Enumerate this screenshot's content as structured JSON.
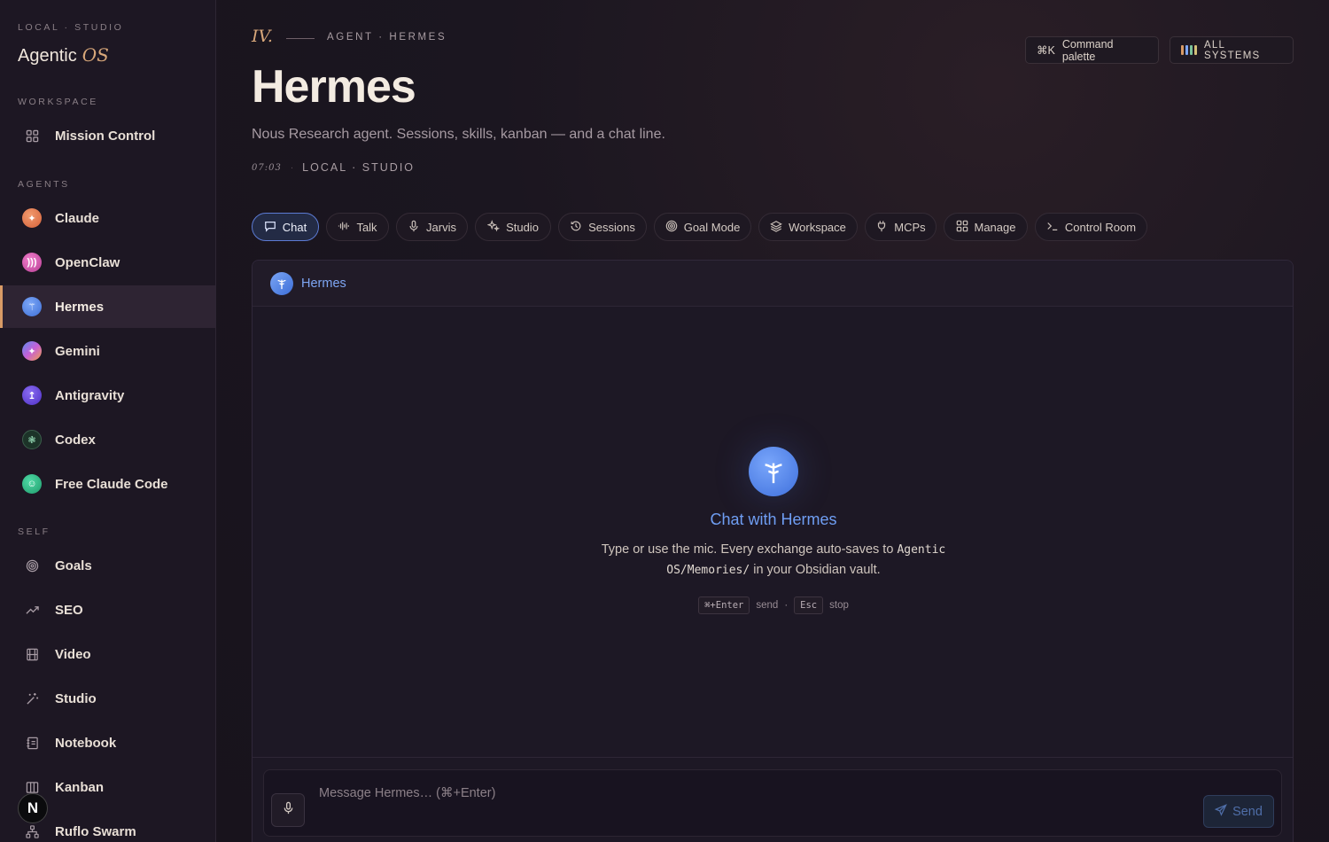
{
  "brand": {
    "eyebrow": "LOCAL · STUDIO",
    "name": "Agentic",
    "name_accent": "OS"
  },
  "sidebar": {
    "workspace_label": "WORKSPACE",
    "workspace_items": [
      {
        "label": "Mission Control",
        "icon": "grid-icon"
      }
    ],
    "agents_label": "AGENTS",
    "agents": [
      {
        "label": "Claude",
        "icon": "claude-icon",
        "color": "#e07a4f"
      },
      {
        "label": "OpenClaw",
        "icon": "openclaw-icon",
        "color": "#d95bb3"
      },
      {
        "label": "Hermes",
        "icon": "hermes-icon",
        "color": "#4d7fe6",
        "active": true
      },
      {
        "label": "Gemini",
        "icon": "gemini-icon",
        "color": "#8a6ae8"
      },
      {
        "label": "Antigravity",
        "icon": "antigravity-icon",
        "color": "#6a4be0"
      },
      {
        "label": "Codex",
        "icon": "codex-icon",
        "color": "#1f3b2e"
      },
      {
        "label": "Free Claude Code",
        "icon": "free-claude-code-icon",
        "color": "#2fbf8a"
      }
    ],
    "self_label": "SELF",
    "self_items": [
      {
        "label": "Goals",
        "icon": "target-icon"
      },
      {
        "label": "SEO",
        "icon": "trending-icon"
      },
      {
        "label": "Video",
        "icon": "film-icon"
      },
      {
        "label": "Studio",
        "icon": "wand-icon"
      },
      {
        "label": "Notebook",
        "icon": "notebook-icon"
      },
      {
        "label": "Kanban",
        "icon": "kanban-icon"
      },
      {
        "label": "Ruflo Swarm",
        "icon": "swarm-icon"
      }
    ],
    "badge": "N"
  },
  "header": {
    "roman": "IV.",
    "eyebrow": "AGENT · HERMES",
    "title": "Hermes",
    "subtitle": "Nous Research agent. Sessions, skills, kanban — and a chat line.",
    "time": "07:03",
    "location": "LOCAL · STUDIO",
    "command_palette": {
      "shortcut": "⌘K",
      "label": "Command palette"
    },
    "systems": {
      "label": "ALL SYSTEMS",
      "bar_colors": [
        "#d99b66",
        "#7ea6f4",
        "#7bc39a",
        "#d3c07a"
      ]
    }
  },
  "tabs": [
    {
      "label": "Chat",
      "icon": "chat-icon",
      "active": true
    },
    {
      "label": "Talk",
      "icon": "waveform-icon"
    },
    {
      "label": "Jarvis",
      "icon": "mic-icon"
    },
    {
      "label": "Studio",
      "icon": "sparkles-icon"
    },
    {
      "label": "Sessions",
      "icon": "history-icon"
    },
    {
      "label": "Goal Mode",
      "icon": "target-icon"
    },
    {
      "label": "Workspace",
      "icon": "layers-icon"
    },
    {
      "label": "MCPs",
      "icon": "plug-icon"
    },
    {
      "label": "Manage",
      "icon": "grid-icon"
    },
    {
      "label": "Control Room",
      "icon": "terminal-icon"
    }
  ],
  "chat": {
    "agent_name": "Hermes",
    "empty_title": "Chat with Hermes",
    "empty_desc_pre": "Type or use the mic. Every exchange auto-saves to",
    "empty_desc_path": "Agentic OS/Memories/",
    "empty_desc_post": "in your Obsidian vault.",
    "shortcut_send_key": "⌘+Enter",
    "shortcut_send_label": "send",
    "shortcut_sep": "·",
    "shortcut_stop_key": "Esc",
    "shortcut_stop_label": "stop",
    "input_placeholder": "Message Hermes… (⌘+Enter)",
    "input_value": "",
    "send_label": "Send"
  },
  "colors": {
    "accent": "#d99b66",
    "hermes_blue": "#4d7fe6"
  }
}
